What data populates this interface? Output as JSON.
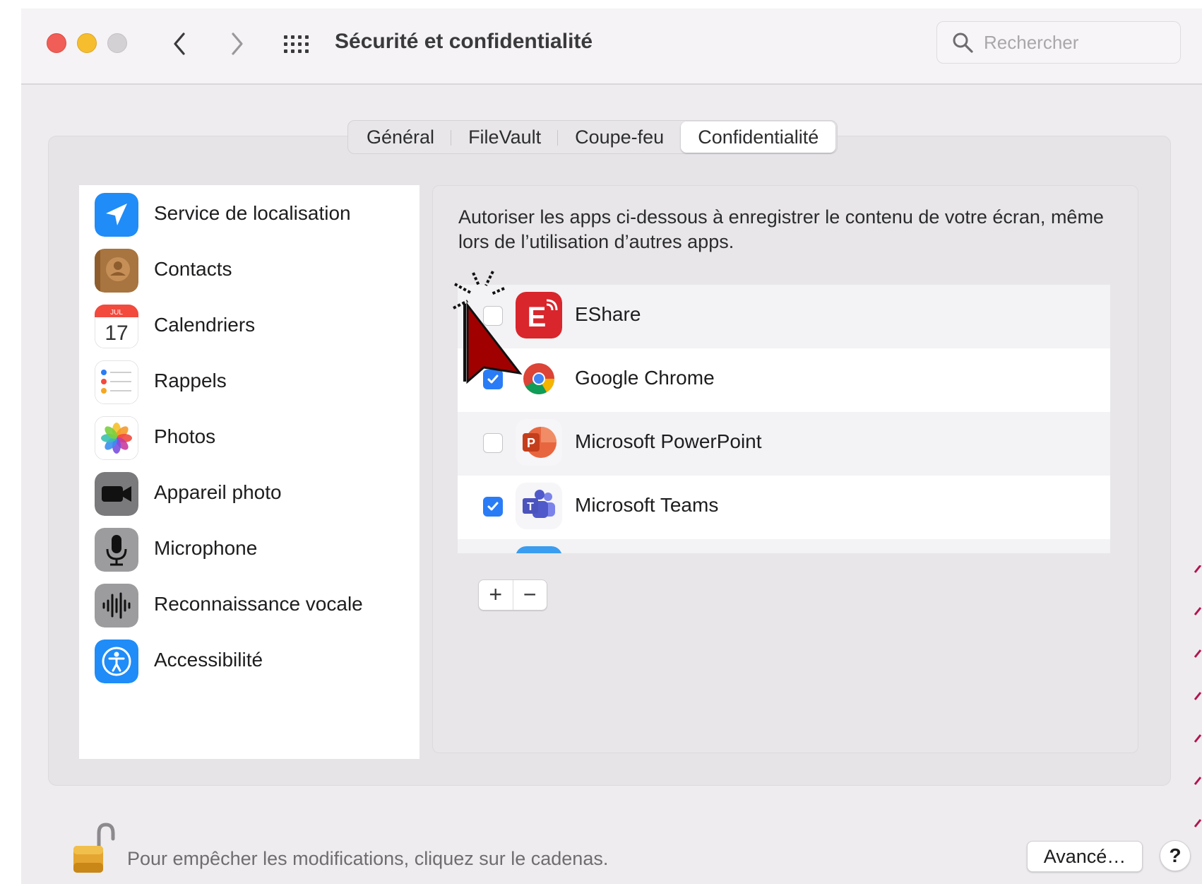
{
  "window": {
    "title": "Sécurité et confidentialité",
    "search": {
      "placeholder": "Rechercher",
      "value": ""
    }
  },
  "tabs": [
    {
      "label": "Général",
      "active": false
    },
    {
      "label": "FileVault",
      "active": false
    },
    {
      "label": "Coupe-feu",
      "active": false
    },
    {
      "label": "Confidentialité",
      "active": true
    }
  ],
  "sidebar": {
    "items": [
      {
        "label": "Service de localisation",
        "icon": "location-arrow-icon"
      },
      {
        "label": "Contacts",
        "icon": "contacts-icon"
      },
      {
        "label": "Calendriers",
        "icon": "calendar-icon",
        "calendar_month": "JUL",
        "calendar_day": "17"
      },
      {
        "label": "Rappels",
        "icon": "reminders-icon"
      },
      {
        "label": "Photos",
        "icon": "photos-icon"
      },
      {
        "label": "Appareil photo",
        "icon": "camera-icon"
      },
      {
        "label": "Microphone",
        "icon": "microphone-icon"
      },
      {
        "label": "Reconnaissance vocale",
        "icon": "speech-recognition-icon"
      },
      {
        "label": "Accessibilité",
        "icon": "accessibility-icon"
      }
    ]
  },
  "content": {
    "description": "Autoriser les apps ci-dessous à enregistrer le contenu de votre écran, même lors de l’utilisation d’autres apps.",
    "apps": [
      {
        "name": "EShare",
        "checked": false,
        "icon": "eshare-icon"
      },
      {
        "name": "Google Chrome",
        "checked": true,
        "icon": "chrome-icon"
      },
      {
        "name": "Microsoft PowerPoint",
        "checked": false,
        "icon": "powerpoint-icon"
      },
      {
        "name": "Microsoft Teams",
        "checked": true,
        "icon": "teams-icon"
      }
    ],
    "add_label": "+",
    "remove_label": "−"
  },
  "footer": {
    "lock_text": "Pour empêcher les modifications, cliquez sur le cadenas.",
    "advanced_label": "Avancé…",
    "help_label": "?"
  },
  "colors": {
    "accent": "#2a7cf6",
    "close": "#f05e57",
    "minimize": "#f6be2f",
    "zoom_disabled": "#d3d1d4"
  }
}
